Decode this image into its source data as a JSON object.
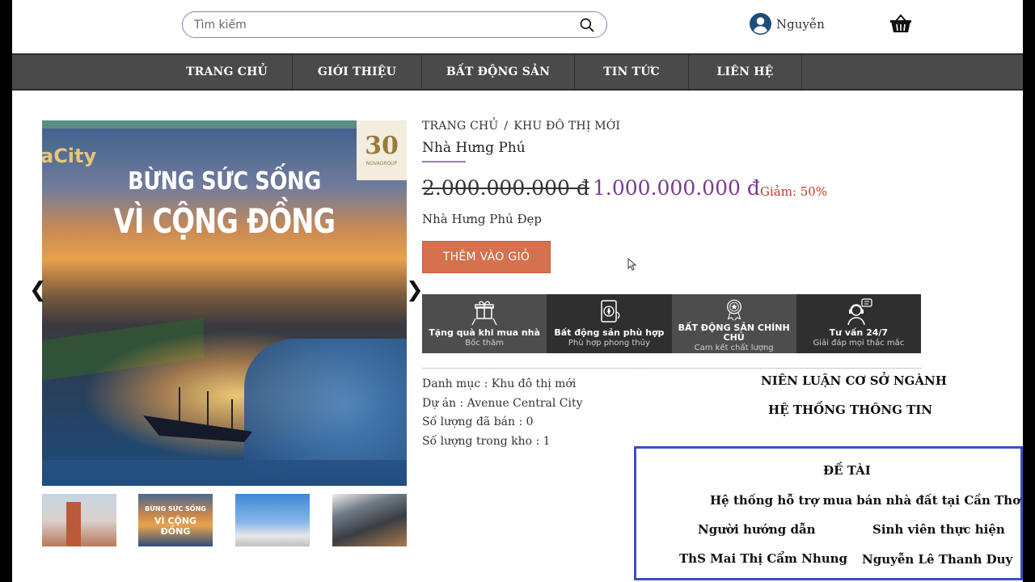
{
  "search": {
    "placeholder": "Tìm kiếm"
  },
  "user": {
    "name": "Nguyễn"
  },
  "nav": [
    "TRANG CHỦ",
    "GIỚI THIỆU",
    "BẤT ĐỘNG SẢN",
    "TIN TỨC",
    "LIÊN HỆ"
  ],
  "gallery": {
    "logo_text": "aCity",
    "badge_number": "30",
    "badge_text": "NOVAGROUP",
    "slogan_line1": "BỪNG SỨC SỐNG",
    "slogan_line2": "VÌ CỘNG ĐỒNG",
    "prev": "❮",
    "next": "❯",
    "thumb2_line1": "BỪNG SỨC SỐNG",
    "thumb2_line2": "VÌ CỘNG ĐỒNG"
  },
  "breadcrumb": {
    "home": "TRANG CHỦ",
    "separator": "/",
    "current": "KHU ĐÔ THỊ MỚI"
  },
  "product": {
    "title": "Nhà Hưng Phú",
    "old_price": "2.000.000.000 đ",
    "new_price": "1.000.000.000 đ",
    "discount": "Giảm: 50%",
    "description": "Nhà Hưng Phú Đẹp",
    "add_to_cart": "THÊM VÀO GIỎ"
  },
  "features": [
    {
      "title": "Tặng quà khi mua nhà",
      "sub": "Bốc thăm",
      "icon": "gift-icon"
    },
    {
      "title": "Bất động sản phù hợp",
      "sub": "Phù hợp phong thủy",
      "icon": "compass-icon"
    },
    {
      "title": "BẤT ĐỘNG SẢN CHÍNH CHỦ",
      "sub": "Cam kết chất lượng",
      "icon": "medal-icon"
    },
    {
      "title": "Tư vấn 24/7",
      "sub": "Giải đáp mọi thắc mắc",
      "icon": "support-agent-icon"
    }
  ],
  "meta": {
    "category": "Danh mục : Khu đô thị mới",
    "project": "Dự án : Avenue Central City",
    "sold": "Số lượng đã bán : 0",
    "stock": "Số lượng trong kho : 1"
  },
  "thesis": {
    "line1": "NIÊN LUẬN CƠ SỞ NGÀNH",
    "line2": "HỆ THỐNG THÔNG TIN",
    "topic_label": "ĐỀ TÀI",
    "topic": "Hệ thống hỗ trợ mua bán nhà đất tại Cần Thơ",
    "advisor_label": "Người hướng dẫn",
    "student_label": "Sinh viên thực hiện",
    "advisor": "ThS Mai Thị Cẩm Nhung",
    "student": "Nguyễn Lê Thanh Duy"
  }
}
